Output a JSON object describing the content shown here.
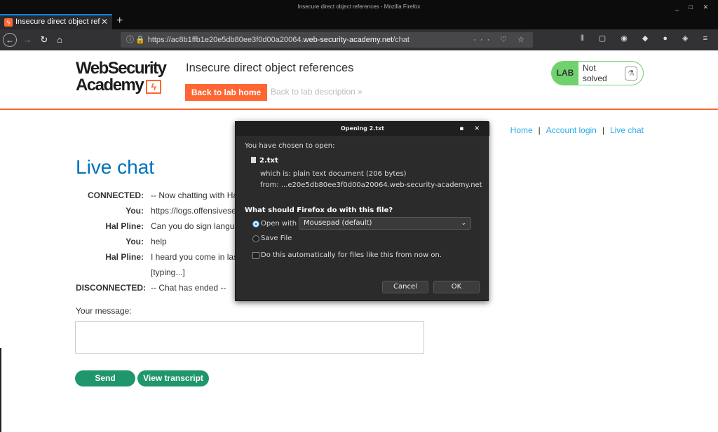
{
  "window": {
    "title": "Insecure direct object references - Mozilla Firefox",
    "controls": "_ □ ✕"
  },
  "tab": {
    "label": "Insecure direct object ref",
    "close": "✕",
    "new": "+"
  },
  "url": {
    "prefix": "https://ac8b1ffb1e20e5db80ee3f0d00a20064.",
    "host": "web-security-academy.net",
    "path": "/chat",
    "actions": "··· ♡ ☆"
  },
  "toolbar_icons": "⫴ ▢ ◉ ◆ ● ◈ ≡",
  "header": {
    "logo_line1": "WebSecurity",
    "logo_line2": "Academy",
    "lab_title": "Insecure direct object references",
    "back_home": "Back to lab home",
    "back_desc": "Back to lab description »",
    "badge_label": "LAB",
    "status_line1": "Not",
    "status_line2": "solved",
    "flask": "⚗"
  },
  "nav": {
    "home": "Home",
    "account": "Account login",
    "chat": "Live chat",
    "sep": "|"
  },
  "chat": {
    "title": "Live chat",
    "rows": [
      {
        "who": "CONNECTED:",
        "msg": "-- Now chatting with Hal"
      },
      {
        "who": "You:",
        "msg": "https://logs.offensivesec"
      },
      {
        "who": "Hal Pline:",
        "msg": "Can you do sign langua"
      },
      {
        "who": "You:",
        "msg": "help"
      },
      {
        "who": "Hal Pline:",
        "msg": "I heard you come in last"
      },
      {
        "who": "",
        "msg": "[typing...]"
      },
      {
        "who": "DISCONNECTED:",
        "msg": "-- Chat has ended --"
      }
    ],
    "message_label": "Your message:",
    "send": "Send",
    "transcript": "View transcript"
  },
  "dialog": {
    "title": "Opening 2.txt",
    "controls": "▪ ✕",
    "chosen": "You have chosen to open:",
    "filename": "2.txt",
    "which_is": "which is:  plain text document (206 bytes)",
    "from": "from:  ...e20e5db80ee3f0d00a20064.web-security-academy.net",
    "question": "What should Firefox do with this file?",
    "open_with": "Open with",
    "app": "Mousepad (default)",
    "chev": "⌄",
    "save_file": "Save File",
    "auto": "Do this automatically for files like this from now on.",
    "cancel": "Cancel",
    "ok": "OK"
  }
}
